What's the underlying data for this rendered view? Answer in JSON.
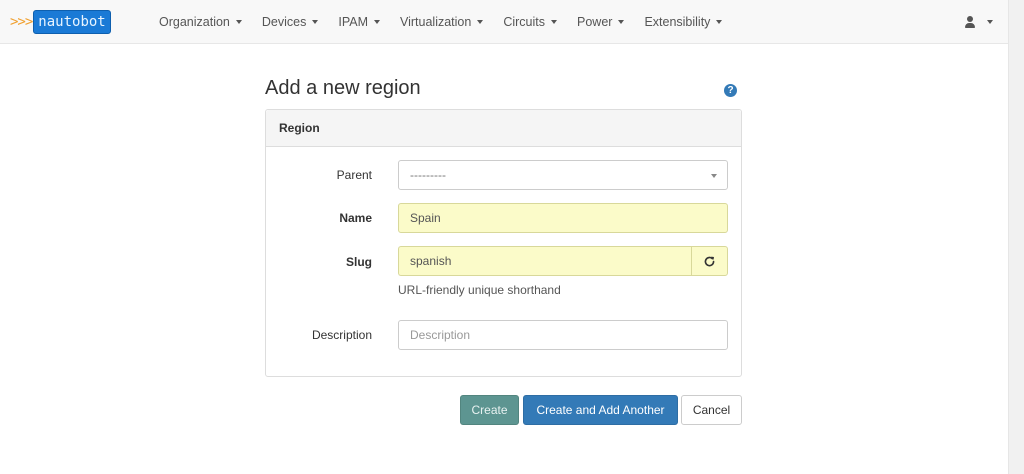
{
  "brand": {
    "arrows": ">>>",
    "name": "nautobot"
  },
  "nav": {
    "items": [
      {
        "label": "Organization"
      },
      {
        "label": "Devices"
      },
      {
        "label": "IPAM"
      },
      {
        "label": "Virtualization"
      },
      {
        "label": "Circuits"
      },
      {
        "label": "Power"
      },
      {
        "label": "Extensibility"
      }
    ]
  },
  "page": {
    "title": "Add a new region",
    "help_icon": "?"
  },
  "panel": {
    "heading": "Region"
  },
  "form": {
    "parent": {
      "label": "Parent",
      "value": "---------"
    },
    "name": {
      "label": "Name",
      "value": "Spain"
    },
    "slug": {
      "label": "Slug",
      "value": "spanish",
      "help": "URL-friendly unique shorthand"
    },
    "description": {
      "label": "Description",
      "value": "",
      "placeholder": "Description"
    }
  },
  "buttons": {
    "create": "Create",
    "create_another": "Create and Add Another",
    "cancel": "Cancel"
  },
  "colors": {
    "primary": "#337ab7",
    "create_button": "#5d9591",
    "filled_field": "#fbfbc9",
    "brand_box": "#1a7ad6",
    "brand_arrows": "#f0a030"
  }
}
